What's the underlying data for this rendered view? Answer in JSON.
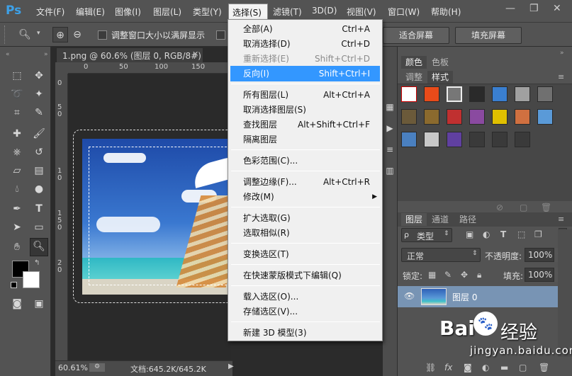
{
  "app": {
    "logo": "Ps"
  },
  "menubar": {
    "items": [
      "文件(F)",
      "编辑(E)",
      "图像(I)",
      "图层(L)",
      "类型(Y)",
      "选择(S)",
      "滤镜(T)",
      "3D(D)",
      "视图(V)",
      "窗口(W)",
      "帮助(H)"
    ],
    "active": "选择(S)"
  },
  "options": {
    "resize_windows_label": "调整窗口大小以满屏显示",
    "fit_screen": "适合屏幕",
    "fill_screen": "填充屏幕"
  },
  "document": {
    "tab_title": "1.png @ 60.6% (图层 0, RGB/8#)",
    "ruler_h": [
      "0",
      "50",
      "100",
      "150"
    ],
    "ruler_v": [
      "0",
      "5",
      "0",
      "1",
      "0",
      "1",
      "5",
      "0",
      "2",
      "0"
    ],
    "zoom": "60.61%",
    "doc_size": "文档:645.2K/645.2K"
  },
  "select_menu": {
    "groups": [
      [
        {
          "label": "全部(A)",
          "shortcut": "Ctrl+A",
          "disabled": false
        },
        {
          "label": "取消选择(D)",
          "shortcut": "Ctrl+D",
          "disabled": false
        },
        {
          "label": "重新选择(E)",
          "shortcut": "Shift+Ctrl+D",
          "disabled": true
        },
        {
          "label": "反向(I)",
          "shortcut": "Shift+Ctrl+I",
          "disabled": false,
          "highlighted": true
        }
      ],
      [
        {
          "label": "所有图层(L)",
          "shortcut": "Alt+Ctrl+A",
          "disabled": false
        },
        {
          "label": "取消选择图层(S)",
          "shortcut": "",
          "disabled": false
        },
        {
          "label": "查找图层",
          "shortcut": "Alt+Shift+Ctrl+F",
          "disabled": false
        },
        {
          "label": "隔离图层",
          "shortcut": "",
          "disabled": false
        }
      ],
      [
        {
          "label": "色彩范围(C)...",
          "shortcut": "",
          "disabled": false
        }
      ],
      [
        {
          "label": "调整边缘(F)...",
          "shortcut": "Alt+Ctrl+R",
          "disabled": false
        },
        {
          "label": "修改(M)",
          "shortcut": "",
          "disabled": false,
          "submenu": true
        }
      ],
      [
        {
          "label": "扩大选取(G)",
          "shortcut": "",
          "disabled": false
        },
        {
          "label": "选取相似(R)",
          "shortcut": "",
          "disabled": false
        }
      ],
      [
        {
          "label": "变换选区(T)",
          "shortcut": "",
          "disabled": false
        }
      ],
      [
        {
          "label": "在快速蒙版模式下编辑(Q)",
          "shortcut": "",
          "disabled": false
        }
      ],
      [
        {
          "label": "载入选区(O)...",
          "shortcut": "",
          "disabled": false
        },
        {
          "label": "存储选区(V)...",
          "shortcut": "",
          "disabled": false
        }
      ],
      [
        {
          "label": "新建 3D 模型(3)",
          "shortcut": "",
          "disabled": false
        }
      ]
    ]
  },
  "panels": {
    "color_tabs": [
      "颜色",
      "色板"
    ],
    "style_tabs": [
      "调整",
      "样式"
    ],
    "layer_tabs": [
      "图层",
      "通道",
      "路径"
    ],
    "kind_filter": "类型",
    "blend_mode": "正常",
    "opacity_label": "不透明度:",
    "opacity_value": "100%",
    "lock_label": "锁定:",
    "fill_label": "填充:",
    "fill_value": "100%",
    "layer_name": "图层 0",
    "swatch_colors": [
      "#ffffff",
      "#e84b1a",
      "#8c8c8c",
      "#2a2a2a",
      "#3a7fd0",
      "#a0a0a0",
      "#707070",
      "#6b5a3a",
      "#8b6a2e",
      "#c03030",
      "#8a4aa0",
      "#e0c000",
      "#d07040",
      "#5a9ad8",
      "#4a80c0",
      "#c8c8c8",
      "#6040a0",
      "#3a3a3a",
      "#3a3a3a",
      "#3a3a3a"
    ]
  },
  "watermark": {
    "brand": "Bai",
    "brand2": "经验",
    "url": "jingyan.baidu.com"
  }
}
